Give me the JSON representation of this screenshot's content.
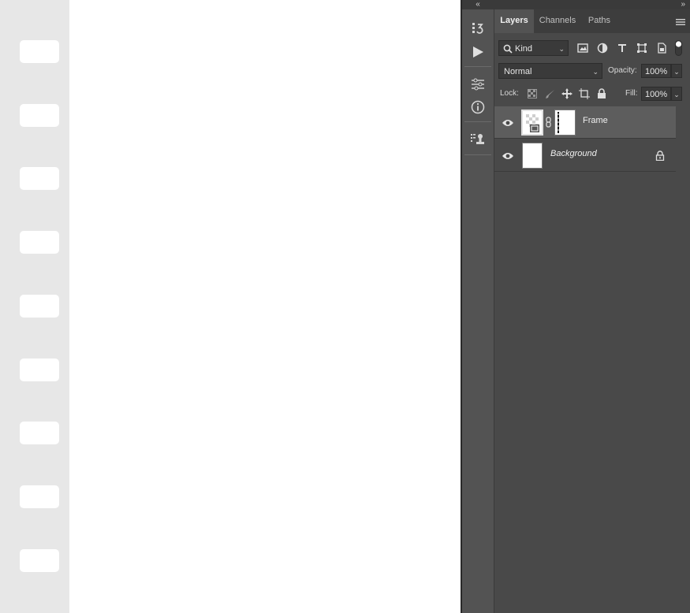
{
  "document": {
    "sprocket_count": 9
  },
  "tool_strip": {
    "icons": [
      "history-icon",
      "play-action-icon",
      "adjustments-icon",
      "info-icon",
      "clone-source-icon"
    ]
  },
  "layers_panel": {
    "tabs": [
      {
        "label": "Layers",
        "active": true
      },
      {
        "label": "Channels",
        "active": false
      },
      {
        "label": "Paths",
        "active": false
      }
    ],
    "filter": {
      "kind_label": "Kind"
    },
    "blend_mode": "Normal",
    "opacity_label": "Opacity:",
    "opacity_value": "100%",
    "lock_label": "Lock:",
    "fill_label": "Fill:",
    "fill_value": "100%",
    "layers": [
      {
        "name": "Frame",
        "selected": true,
        "visible": true,
        "has_mask": true,
        "locked": false
      },
      {
        "name": "Background",
        "selected": false,
        "visible": true,
        "has_mask": false,
        "locked": true
      }
    ]
  },
  "colors": {
    "panel_bg": "#494949",
    "tool_strip_bg": "#535353",
    "selected_row": "#5d5d5d",
    "film_strip": "#e7e7e7"
  }
}
